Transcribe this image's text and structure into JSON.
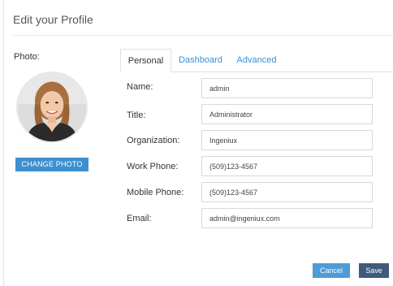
{
  "dialog": {
    "title": "Edit your Profile"
  },
  "photo": {
    "label": "Photo:",
    "change_label": "CHANGE PHOTO"
  },
  "tabs": [
    {
      "label": "Personal",
      "active": true
    },
    {
      "label": "Dashboard",
      "active": false
    },
    {
      "label": "Advanced",
      "active": false
    }
  ],
  "fields": {
    "name": {
      "label": "Name:",
      "value": "admin"
    },
    "title": {
      "label": "Title:",
      "value": "Administrator"
    },
    "organization": {
      "label": "Organization:",
      "value": "Ingeniux"
    },
    "work_phone": {
      "label": "Work Phone:",
      "value": "(509)123-4567"
    },
    "mobile_phone": {
      "label": "Mobile Phone:",
      "value": "(509)123-4567"
    },
    "email": {
      "label": "Email:",
      "value": "admin@ingeniux.com"
    }
  },
  "footer": {
    "cancel_label": "Cancel",
    "save_label": "Save"
  },
  "colors": {
    "accent": "#3d8fd0",
    "save": "#3f5a7c",
    "tab_link": "#3c8fd1"
  },
  "icons": {
    "avatar": "user-photo"
  }
}
